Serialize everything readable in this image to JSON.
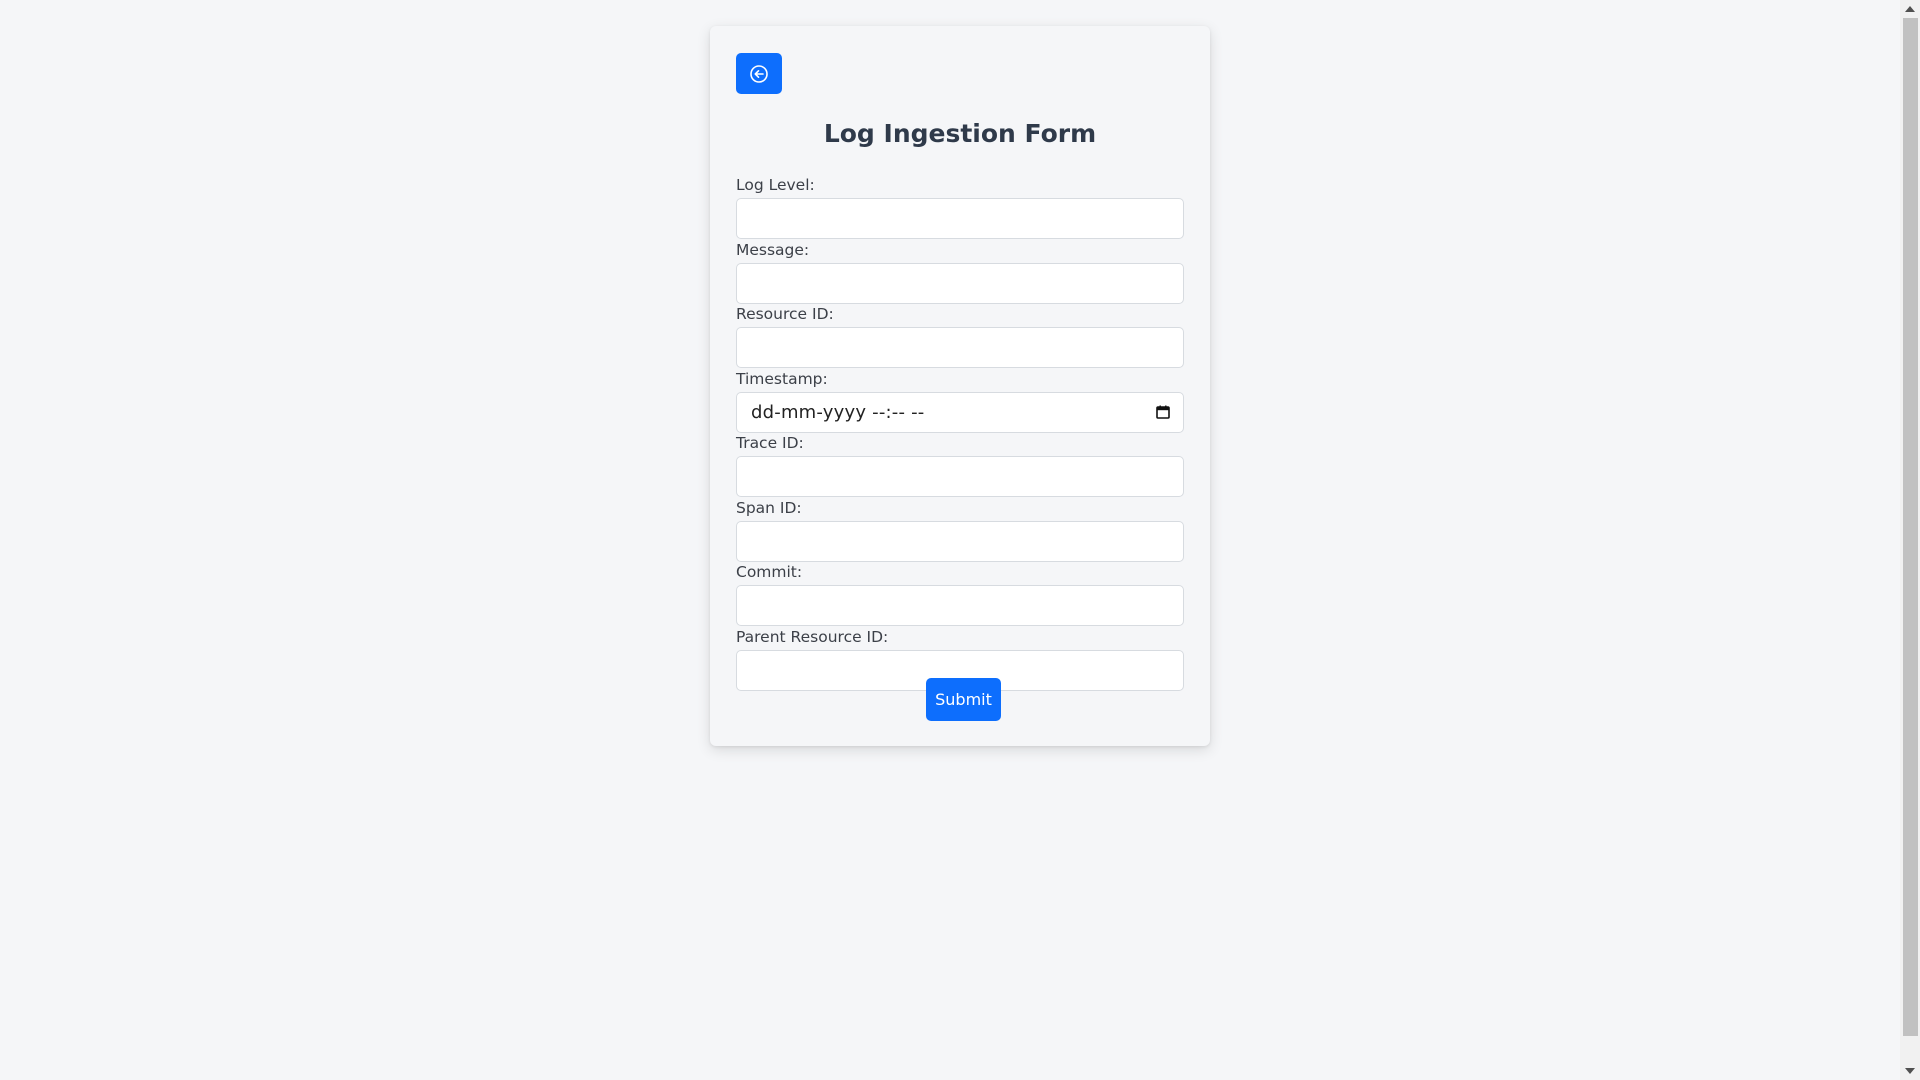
{
  "page": {
    "title": "Log Ingestion Form"
  },
  "header": {
    "back_icon": "arrow-left-circle-icon"
  },
  "form": {
    "fields": [
      {
        "label": "Log Level:",
        "value": ""
      },
      {
        "label": "Message:",
        "value": ""
      },
      {
        "label": "Resource ID:",
        "value": ""
      },
      {
        "label": "Timestamp:",
        "placeholder": "dd-mm-yyyy --:-- --"
      },
      {
        "label": "Trace ID:",
        "value": ""
      },
      {
        "label": "Span ID:",
        "value": ""
      },
      {
        "label": "Commit:",
        "value": ""
      },
      {
        "label": "Parent Resource ID:",
        "value": ""
      }
    ],
    "submit_label": "Submit"
  },
  "colors": {
    "accent": "#0d6efd",
    "background": "#f5f6f8"
  }
}
